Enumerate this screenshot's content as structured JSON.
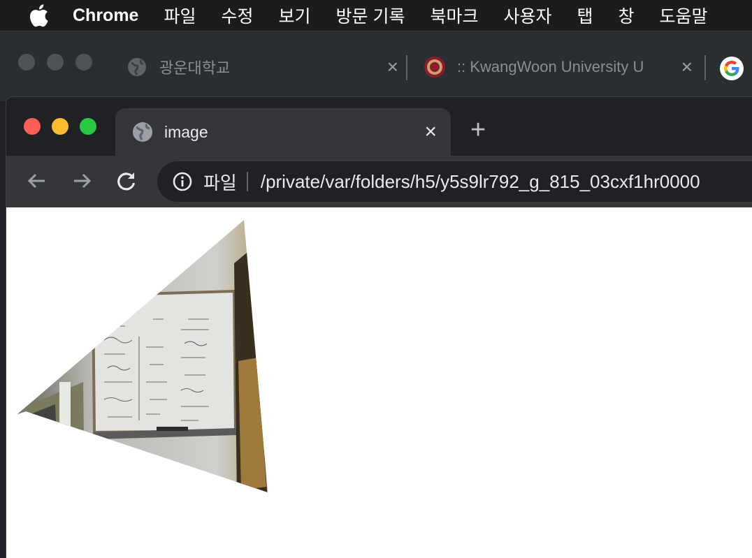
{
  "menubar": {
    "app": "Chrome",
    "items": [
      "파일",
      "수정",
      "보기",
      "방문 기록",
      "북마크",
      "사용자",
      "탭",
      "창",
      "도움말"
    ]
  },
  "background_window": {
    "tabs": [
      {
        "title": "광운대학교"
      },
      {
        "title": ":: KwangWoon University U"
      }
    ]
  },
  "window": {
    "tab": {
      "title": "image"
    },
    "omnibox": {
      "scheme": "파일",
      "url": "/private/var/folders/h5/y5s9lr792_g_815_03cxf1hr0000"
    }
  },
  "content": {
    "image": {
      "subject": "perspective-warped photo of a whiteboard with handwritten equations"
    }
  },
  "colors": {
    "menubar": "#1c1c1e",
    "toolbar": "#35363a",
    "close": "#fe5f57",
    "minimize": "#febc2e",
    "zoom": "#28c840"
  }
}
